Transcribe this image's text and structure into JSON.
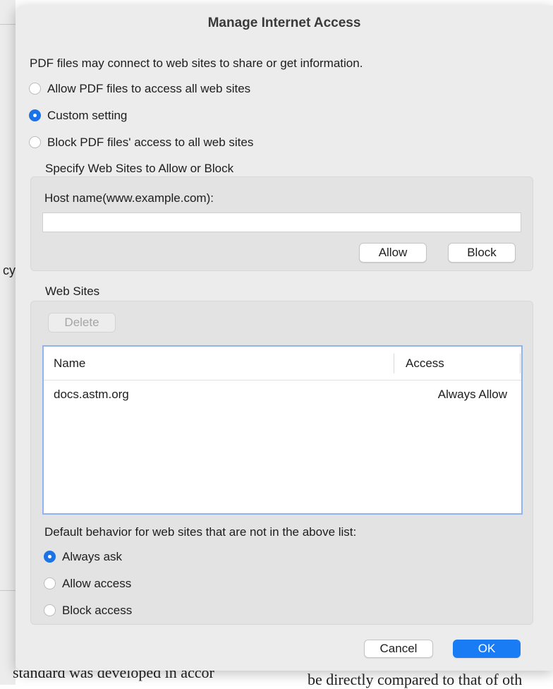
{
  "background": {
    "left_fragment": "cy",
    "bottom_left_text": "standard was developed in accor",
    "bottom_right_text": "be directly compared to that of oth"
  },
  "dialog": {
    "title": "Manage Internet Access",
    "intro": "PDF files may connect to web sites to share or get information.",
    "access_options": [
      {
        "label": "Allow PDF files to access all web sites",
        "selected": false
      },
      {
        "label": "Custom setting",
        "selected": true
      },
      {
        "label": "Block PDF files' access to all web sites",
        "selected": false
      }
    ],
    "specify_section": {
      "heading": "Specify Web Sites to Allow or Block",
      "host_label": "Host name(www.example.com):",
      "host_value": "",
      "allow_label": "Allow",
      "block_label": "Block"
    },
    "web_sites": {
      "heading": "Web Sites",
      "delete_label": "Delete",
      "columns": [
        "Name",
        "Access"
      ],
      "rows": [
        {
          "name": "docs.astm.org",
          "access": "Always Allow"
        }
      ]
    },
    "default_behavior": {
      "heading": "Default behavior for web sites that are not in the above list:",
      "options": [
        {
          "label": "Always ask",
          "selected": true
        },
        {
          "label": "Allow access",
          "selected": false
        },
        {
          "label": "Block access",
          "selected": false
        }
      ]
    },
    "cancel_label": "Cancel",
    "ok_label": "OK",
    "accent_color": "#1a7cf5"
  }
}
